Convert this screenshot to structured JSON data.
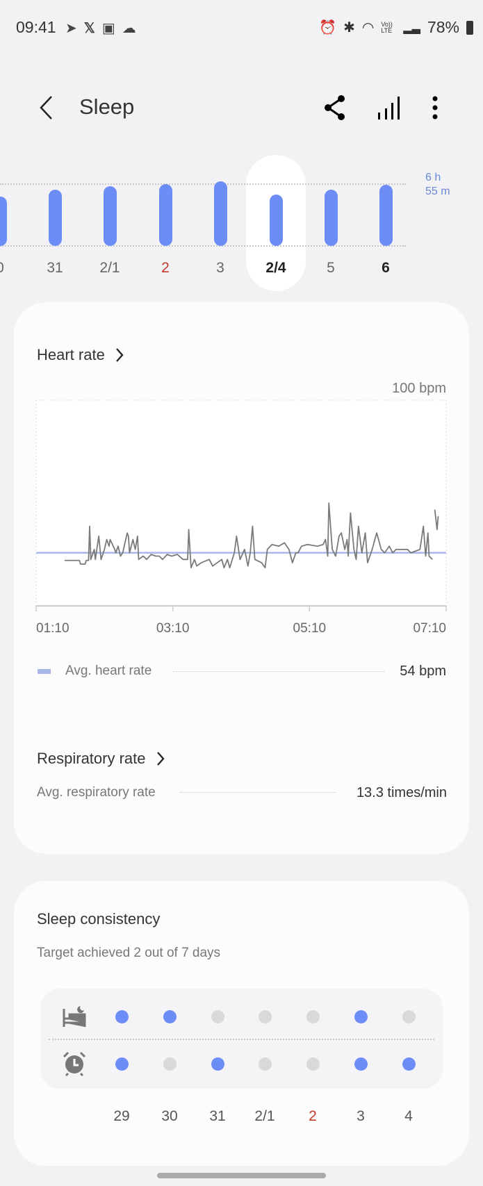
{
  "status_bar": {
    "time": "09:41",
    "battery": "78%",
    "left_icons": [
      "telegram-icon",
      "x-icon",
      "gallery-icon",
      "cloud-icon"
    ],
    "right_icons": [
      "alarm-icon",
      "bluetooth-icon",
      "wifi-icon",
      "volte-icon",
      "signal-icon",
      "battery-icon"
    ],
    "volte_label": "Vo)) LTE"
  },
  "header": {
    "title": "Sleep",
    "icons": [
      "back-icon",
      "share-icon",
      "stats-icon",
      "more-icon"
    ]
  },
  "sleep_bars": {
    "reference_label_1": "6 h",
    "reference_label_2": "55 m",
    "color": "#6c8cf6",
    "selected": "2/4",
    "days": [
      {
        "label": "0",
        "hours": 5.5
      },
      {
        "label": "31",
        "hours": 6.3
      },
      {
        "label": "2/1",
        "hours": 6.7
      },
      {
        "label": "2",
        "hours": 6.9,
        "holiday": true
      },
      {
        "label": "3",
        "hours": 7.2
      },
      {
        "label": "2/4",
        "hours": 5.75,
        "selected": true
      },
      {
        "label": "5",
        "hours": 6.3
      },
      {
        "label": "6",
        "hours": 6.85,
        "bold": true
      }
    ]
  },
  "heart_rate": {
    "title": "Heart rate",
    "max_label": "100 bpm",
    "avg_label": "Avg. heart rate",
    "avg_value": "54 bpm",
    "avg_color": "#a9b6ea",
    "x_ticks": [
      "01:10",
      "03:10",
      "05:10",
      "07:10"
    ]
  },
  "respiratory": {
    "title": "Respiratory rate",
    "avg_label": "Avg. respiratory rate",
    "avg_value": "13.3 times/min"
  },
  "consistency": {
    "title": "Sleep consistency",
    "subtitle": "Target achieved 2 out of 7 days",
    "on_color": "#6c8cf6",
    "off_color": "#d9d9db",
    "dates": [
      {
        "label": "29"
      },
      {
        "label": "30"
      },
      {
        "label": "31"
      },
      {
        "label": "2/1"
      },
      {
        "label": "2",
        "holiday": true
      },
      {
        "label": "3"
      },
      {
        "label": "4"
      }
    ],
    "bedtime": [
      true,
      true,
      false,
      false,
      false,
      true,
      false
    ],
    "wakeup": [
      true,
      false,
      true,
      false,
      false,
      true,
      true
    ]
  },
  "chart_data": {
    "type": "line",
    "title": "Heart rate",
    "ylabel": "bpm",
    "xlim": [
      "01:10",
      "07:10"
    ],
    "ylim": [
      38,
      100
    ],
    "grid": false,
    "x_ticks": [
      "01:10",
      "03:10",
      "05:10",
      "07:10"
    ],
    "series": [
      {
        "name": "Avg. heart rate",
        "values_const": 54
      },
      {
        "points_min_after_0110_bpm": [
          [
            25,
            51.7
          ],
          [
            38,
            51.7
          ],
          [
            39,
            50.6
          ],
          [
            43,
            50.6
          ],
          [
            44,
            51.7
          ],
          [
            46,
            51.7
          ],
          [
            47,
            62
          ],
          [
            48,
            52
          ],
          [
            51,
            55
          ],
          [
            52,
            52
          ],
          [
            55,
            59
          ],
          [
            57,
            52
          ],
          [
            60,
            55
          ],
          [
            62,
            58
          ],
          [
            64,
            56
          ],
          [
            65,
            58
          ],
          [
            69,
            55
          ],
          [
            70,
            54
          ],
          [
            72,
            56
          ],
          [
            74,
            53
          ],
          [
            76,
            54
          ],
          [
            80,
            60
          ],
          [
            81,
            59
          ],
          [
            82,
            54
          ],
          [
            85,
            58
          ],
          [
            87,
            55
          ],
          [
            89,
            59
          ],
          [
            90,
            52
          ],
          [
            94,
            53
          ],
          [
            97,
            52
          ],
          [
            101,
            53.5
          ],
          [
            105,
            53
          ],
          [
            108,
            53
          ],
          [
            111,
            52
          ],
          [
            115,
            53.5
          ],
          [
            119,
            53
          ],
          [
            124,
            53.5
          ],
          [
            129,
            52
          ],
          [
            133,
            52
          ],
          [
            134,
            61
          ],
          [
            136,
            49.5
          ],
          [
            139,
            52
          ],
          [
            141,
            50
          ],
          [
            145,
            51
          ],
          [
            152,
            52
          ],
          [
            155,
            50
          ],
          [
            163,
            52
          ],
          [
            165,
            49.5
          ],
          [
            168,
            52
          ],
          [
            170,
            49.5
          ],
          [
            174,
            54
          ],
          [
            176,
            59
          ],
          [
            179,
            52
          ],
          [
            183,
            55
          ],
          [
            186,
            50
          ],
          [
            188,
            54
          ],
          [
            190,
            62
          ],
          [
            192,
            52
          ],
          [
            198,
            51
          ],
          [
            201,
            49.5
          ],
          [
            203,
            55
          ],
          [
            207,
            56.5
          ],
          [
            213,
            56
          ],
          [
            218,
            57
          ],
          [
            222,
            55
          ],
          [
            225,
            51
          ],
          [
            228,
            54
          ],
          [
            230,
            54
          ],
          [
            233,
            56
          ],
          [
            238,
            56.5
          ],
          [
            247,
            56
          ],
          [
            252,
            56.5
          ],
          [
            254,
            58
          ],
          [
            256,
            53
          ],
          [
            257,
            69
          ],
          [
            260,
            55
          ],
          [
            263,
            53
          ],
          [
            266,
            59
          ],
          [
            268,
            60
          ],
          [
            271,
            55
          ],
          [
            273,
            58
          ],
          [
            274,
            53
          ],
          [
            276,
            66
          ],
          [
            279,
            55
          ],
          [
            281,
            52
          ],
          [
            283,
            62
          ],
          [
            286,
            54
          ],
          [
            289,
            60
          ],
          [
            291,
            51
          ],
          [
            295,
            55
          ],
          [
            299,
            60
          ],
          [
            303,
            55
          ],
          [
            306,
            54
          ],
          [
            310,
            56
          ],
          [
            313,
            54
          ],
          [
            316,
            55
          ],
          [
            326,
            55
          ],
          [
            329,
            54
          ],
          [
            337,
            55
          ],
          [
            340,
            62
          ],
          [
            342,
            53
          ],
          [
            344,
            60
          ],
          [
            345,
            53
          ],
          [
            348,
            52
          ],
          null,
          [
            350,
            67
          ],
          [
            352,
            61
          ],
          [
            353,
            65
          ]
        ]
      }
    ]
  }
}
